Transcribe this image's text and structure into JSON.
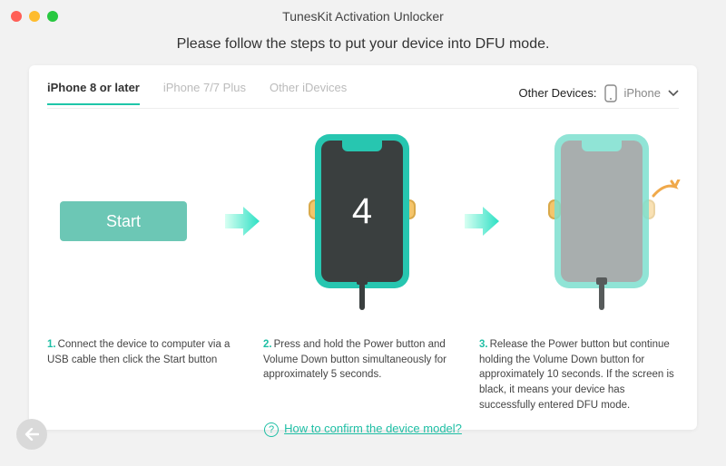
{
  "window": {
    "title": "TunesKit Activation Unlocker"
  },
  "header": {
    "subtitle": "Please follow the steps to put your device into DFU mode."
  },
  "tabs": {
    "items": [
      {
        "label": "iPhone 8 or later",
        "active": true
      },
      {
        "label": "iPhone 7/7 Plus",
        "active": false
      },
      {
        "label": "Other iDevices",
        "active": false
      }
    ],
    "other_devices_label": "Other Devices:",
    "device_selected": "iPhone"
  },
  "start_label": "Start",
  "countdown": "4",
  "steps": [
    {
      "num": "1.",
      "text": "Connect the device to computer via a USB cable then click the Start button"
    },
    {
      "num": "2.",
      "text": "Press and hold the Power button and Volume Down button simultaneously for approximately 5 seconds."
    },
    {
      "num": "3.",
      "text": "Release the Power button but continue holding the Volume Down button for approximately 10 seconds. If the screen is black, it means your device has successfully entered DFU mode."
    }
  ],
  "help_link": "How to confirm the device model?",
  "colors": {
    "accent": "#1fbfa5"
  }
}
